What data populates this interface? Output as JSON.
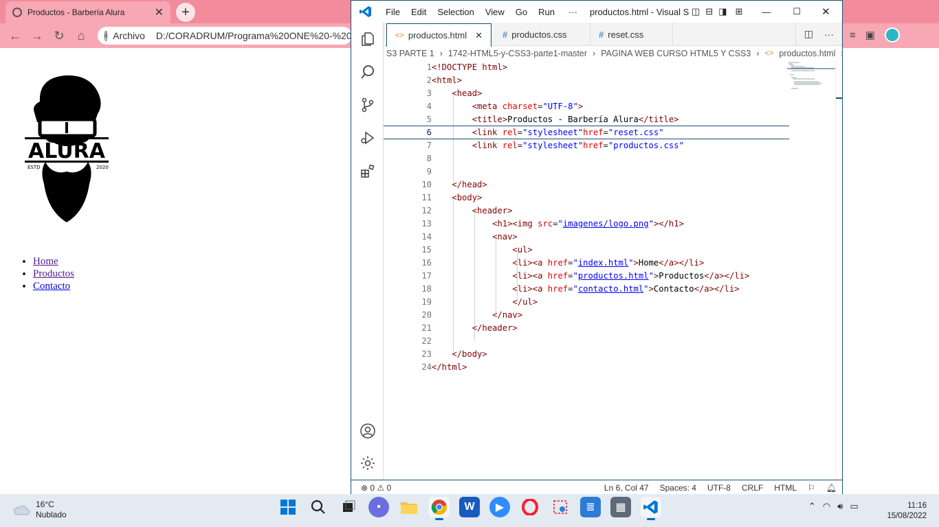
{
  "browser": {
    "tab_title": "Productos - Barbería Alura",
    "omnibox_scheme": "Archivo",
    "omnibox_url": "D:/CORADRUM/Programa%20ONE%20-%20"
  },
  "page": {
    "logo_text": "ALURA",
    "logo_left": "ESTD",
    "logo_right": "2020",
    "nav": [
      "Home",
      "Productos",
      "Contacto"
    ]
  },
  "vscode": {
    "menu": [
      "File",
      "Edit",
      "Selection",
      "View",
      "Go",
      "Run",
      "···"
    ],
    "window_title": "productos.html - Visual S...",
    "tabs": [
      {
        "label": "productos.html",
        "icon": "html-icon",
        "active": true
      },
      {
        "label": "productos.css",
        "icon": "css-icon",
        "active": false
      },
      {
        "label": "reset.css",
        "icon": "css-icon",
        "active": false
      }
    ],
    "breadcrumb": [
      "S3 PARTE 1",
      "1742-HTML5-y-CSS3-parte1-master",
      "PAGINA WEB CURSO HTML5 Y CSS3",
      "productos.html"
    ],
    "line_numbers": [
      "1",
      "2",
      "3",
      "4",
      "5",
      "6",
      "7",
      "8",
      "9",
      "10",
      "11",
      "12",
      "13",
      "14",
      "15",
      "16",
      "17",
      "18",
      "19",
      "20",
      "21",
      "22",
      "23",
      "24"
    ],
    "status": {
      "errors": "0",
      "warnings": "0",
      "position": "Ln 6, Col 47",
      "spaces": "Spaces: 4",
      "encoding": "UTF-8",
      "eol": "CRLF",
      "language": "HTML"
    }
  },
  "taskbar": {
    "temperature": "16°C",
    "weather": "Nublado",
    "time": "11:16",
    "date": "15/08/2022"
  }
}
